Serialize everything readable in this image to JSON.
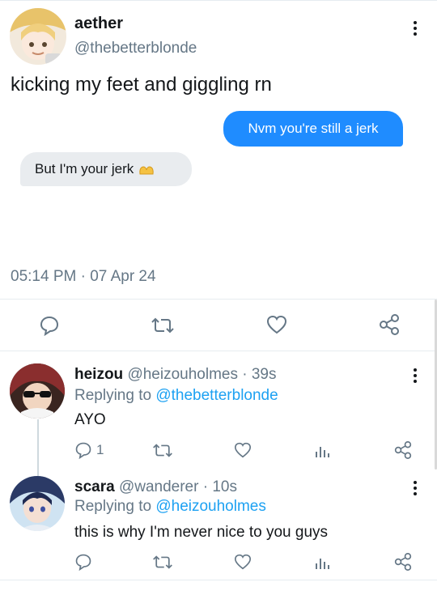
{
  "main_tweet": {
    "display_name": "aether",
    "handle": "@thebetterblonde",
    "text": "kicking my feet and giggling rn",
    "message_sent": "Nvm you're still a jerk",
    "message_received": "But I'm your jerk",
    "timestamp": "05:14 PM · 07 Apr 24"
  },
  "replies": [
    {
      "display_name": "heizou",
      "handle_time": "@heizouholmes · 39s",
      "replying_prefix": "Replying to",
      "replying_to": "@thebetterblonde",
      "text": "AYO",
      "reply_count": "1"
    },
    {
      "display_name": "scara",
      "handle_time": "@wanderer · 10s",
      "replying_prefix": "Replying to",
      "replying_to": "@heizouholmes",
      "text": "this is why I'm never nice to you guys",
      "reply_count": ""
    }
  ],
  "colors": {
    "accent": "#1da1f2",
    "bubble_blue": "#1f8cff",
    "bubble_gray": "#e9ecef",
    "muted": "#657786"
  },
  "icons": [
    "more-vertical-icon",
    "reply-icon",
    "retweet-icon",
    "like-icon",
    "share-icon",
    "analytics-icon",
    "heart-hands-emoji"
  ]
}
